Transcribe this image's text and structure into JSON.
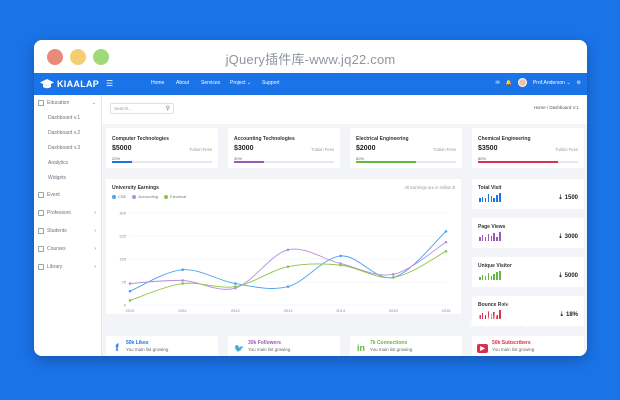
{
  "window": {
    "title": "jQuery插件库-www.jq22.com"
  },
  "brand": {
    "name": "KIAALAP"
  },
  "topnav": {
    "items": [
      "Home",
      "About",
      "Services",
      "Project ⌄",
      "Support"
    ],
    "user": "Prof.Anderson ⌄",
    "icons": [
      "mail-icon",
      "bell-icon",
      "user-avatar",
      "settings-icon"
    ]
  },
  "sidebar": {
    "education": "Education",
    "sub": [
      "Dashboard v.1",
      "Dashboard v.2",
      "Dashboard v.3",
      "Analytics",
      "Widgets"
    ],
    "items": [
      "Event",
      "Professors",
      "Students",
      "Courses",
      "Library"
    ]
  },
  "search": {
    "placeholder": "Search..."
  },
  "breadcrumb": "Home / Dashboard V.1",
  "stats": [
    {
      "name": "Computer Technologies",
      "value": "$5000",
      "sub": "Tuition Fees",
      "pct": "20%",
      "fill": 0.2,
      "color": "#1b73e8"
    },
    {
      "name": "Accounting Technologies",
      "value": "$3000",
      "sub": "Tuition Fees",
      "pct": "30%",
      "fill": 0.3,
      "color": "#9b59b6"
    },
    {
      "name": "Electrical Engineering",
      "value": "$2000",
      "sub": "Tuition Fees",
      "pct": "60%",
      "fill": 0.6,
      "color": "#65b741"
    },
    {
      "name": "Chemical Engineering",
      "value": "$3500",
      "sub": "Tuition Fees",
      "pct": "80%",
      "fill": 0.8,
      "color": "#d9304d"
    }
  ],
  "chart_data": {
    "type": "line",
    "title": "University Earnings",
    "note": "All Earnings are in million $",
    "x": [
      "2010",
      "2011",
      "2012",
      "2013",
      "2014",
      "2015",
      "2016"
    ],
    "yticks": [
      "0",
      "75",
      "150",
      "225",
      "300"
    ],
    "ylim": [
      0,
      300
    ],
    "series": [
      {
        "name": "CSE",
        "color": "#4aa3ef",
        "values": [
          45,
          115,
          70,
          60,
          160,
          90,
          240
        ]
      },
      {
        "name": "Accounting",
        "color": "#b88ce0",
        "values": [
          70,
          80,
          55,
          180,
          135,
          100,
          205
        ]
      },
      {
        "name": "Electrical",
        "color": "#8bc34a",
        "values": [
          15,
          70,
          60,
          125,
          130,
          90,
          175
        ]
      }
    ]
  },
  "side_stats": [
    {
      "title": "Total Visit",
      "value": "⇣ 1500",
      "color": "#1b73e8",
      "bars": [
        0.4,
        0.6,
        0.5,
        0.9,
        0.7,
        0.5,
        0.8,
        1.0
      ]
    },
    {
      "title": "Page Views",
      "value": "⇣ 3000",
      "color": "#9b59b6",
      "bars": [
        0.5,
        0.7,
        0.4,
        0.8,
        0.6,
        0.9,
        0.5,
        1.0
      ]
    },
    {
      "title": "Unique Visitor",
      "value": "⇣ 5000",
      "color": "#65b741",
      "bars": [
        0.3,
        0.6,
        0.5,
        0.8,
        0.4,
        0.7,
        0.9,
        1.0
      ]
    },
    {
      "title": "Bounce Rate",
      "value": "⇣ 18%",
      "color": "#d9304d",
      "bars": [
        0.4,
        0.7,
        0.5,
        0.9,
        0.6,
        0.8,
        0.5,
        1.0
      ]
    }
  ],
  "social": [
    {
      "icon": "f",
      "icon_name": "facebook-icon",
      "label": "50k Likes",
      "desc": "You main list growing",
      "color": "#1b73e8"
    },
    {
      "icon": "🐦",
      "icon_name": "twitter-icon",
      "label": "30k Followers",
      "desc": "You main list growing",
      "color": "#9b59b6"
    },
    {
      "icon": "in",
      "icon_name": "linkedin-icon",
      "label": "7k Connections",
      "desc": "You main list growing",
      "color": "#65b741"
    },
    {
      "icon": "▶",
      "icon_name": "youtube-icon",
      "label": "50k Subscribers",
      "desc": "You main list growing",
      "color": "#d9304d"
    }
  ],
  "watermark": {
    "text": "jQuery",
    "cn": "插件库"
  }
}
